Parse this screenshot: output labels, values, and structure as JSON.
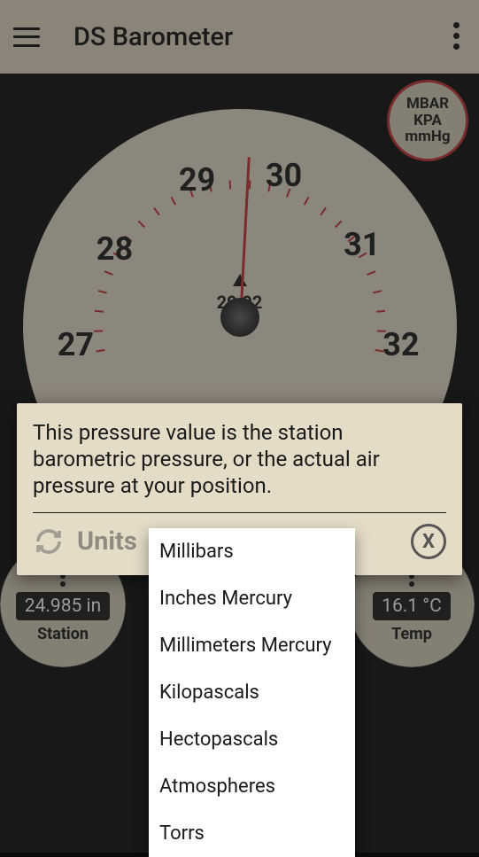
{
  "header": {
    "title": "DS Barometer"
  },
  "unit_badge": {
    "line1": "MBAR",
    "line2": "KPA",
    "line3": "mmHg"
  },
  "gauge": {
    "center_value": "29.92",
    "numbers": [
      "27",
      "28",
      "29",
      "30",
      "31",
      "32"
    ]
  },
  "dialog": {
    "text": "This pressure value is the station barometric pressure, or the actual air pressure at your position.",
    "units_label": "Units",
    "close_label": "X"
  },
  "dropdown": {
    "items": [
      "Millibars",
      "Inches Mercury",
      "Millimeters Mercury",
      "Kilopascals",
      "Hectopascals",
      "Atmospheres",
      "Torrs"
    ]
  },
  "mini_gauges": {
    "station": {
      "value": "24.985 in",
      "label": "Station"
    },
    "temp": {
      "value": "16.1 °C",
      "label": "Temp"
    }
  }
}
